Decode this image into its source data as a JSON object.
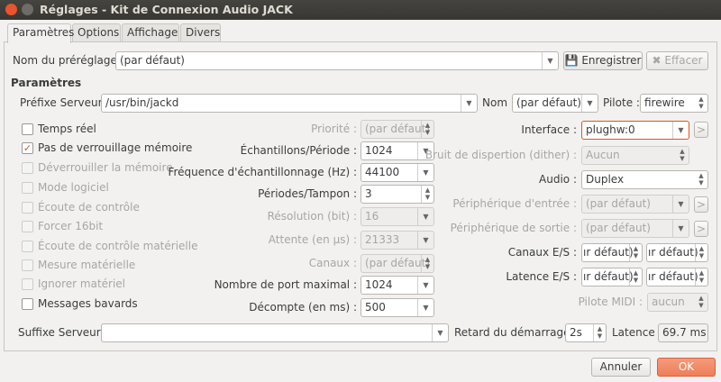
{
  "window": {
    "title": "Réglages - Kit de Connexion Audio JACK"
  },
  "tabs": [
    "Paramètres",
    "Options",
    "Affichage",
    "Divers"
  ],
  "preset": {
    "label": "Nom du préréglage :",
    "value": "(par défaut)",
    "save": "Enregistrer",
    "clear": "Effacer"
  },
  "section_title": "Paramètres",
  "server": {
    "prefix_label": "Préfixe Serveur :",
    "prefix_value": "/usr/bin/jackd",
    "name_label": "Nom :",
    "name_value": "(par défaut)",
    "driver_label": "Pilote :",
    "driver_value": "firewire"
  },
  "checkboxes": [
    {
      "label": "Temps réel",
      "checked": false,
      "enabled": true
    },
    {
      "label": "Pas de verrouillage mémoire",
      "checked": true,
      "enabled": true
    },
    {
      "label": "Déverrouiller la mémoire",
      "checked": false,
      "enabled": false
    },
    {
      "label": "Mode logiciel",
      "checked": false,
      "enabled": false
    },
    {
      "label": "Écoute de contrôle",
      "checked": false,
      "enabled": false
    },
    {
      "label": "Forcer 16bit",
      "checked": false,
      "enabled": false
    },
    {
      "label": "Écoute de contrôle matérielle",
      "checked": false,
      "enabled": false
    },
    {
      "label": "Mesure matérielle",
      "checked": false,
      "enabled": false
    },
    {
      "label": "Ignorer matériel",
      "checked": false,
      "enabled": false
    },
    {
      "label": "Messages bavards",
      "checked": false,
      "enabled": true
    }
  ],
  "middle": [
    {
      "label": "Priorité :",
      "value": "(par défaut)",
      "enabled": false,
      "kind": "spin"
    },
    {
      "label": "Échantillons/Période :",
      "value": "1024",
      "enabled": true,
      "kind": "combo"
    },
    {
      "label": "Fréquence d'échantillonnage (Hz) :",
      "value": "44100",
      "enabled": true,
      "kind": "combo"
    },
    {
      "label": "Périodes/Tampon :",
      "value": "3",
      "enabled": true,
      "kind": "spin"
    },
    {
      "label": "Résolution (bit) :",
      "value": "16",
      "enabled": false,
      "kind": "combo"
    },
    {
      "label": "Attente (en µs) :",
      "value": "21333",
      "enabled": false,
      "kind": "combo"
    },
    {
      "label": "Canaux :",
      "value": "(par défaut)",
      "enabled": false,
      "kind": "spin"
    },
    {
      "label": "Nombre de port maximal :",
      "value": "1024",
      "enabled": true,
      "kind": "combo"
    },
    {
      "label": "Décompte (en ms) :",
      "value": "500",
      "enabled": true,
      "kind": "combo"
    }
  ],
  "right": {
    "interface_label": "Interface :",
    "interface_value": "plughw:0",
    "dither_label": "Bruit de dispertion (dither) :",
    "dither_value": "Aucun",
    "audio_label": "Audio :",
    "audio_value": "Duplex",
    "input_label": "Périphérique d'entrée :",
    "input_value": "(par défaut)",
    "output_label": "Périphérique de sortie :",
    "output_value": "(par défaut)",
    "channels_label": "Canaux E/S :",
    "channels_in": "ır défaut)",
    "channels_out": "ır défaut)",
    "latency_label": "Latence E/S :",
    "latency_in": "ır défaut)",
    "latency_out": "ır défaut)",
    "midi_label": "Pilote MIDI :",
    "midi_value": "aucun",
    "arrow": ">"
  },
  "bottom": {
    "suffix_label": "Suffixe Serveur :",
    "suffix_value": "",
    "delay_label": "Retard du démarrage :",
    "delay_value": "2s",
    "latency_label": "Latence :",
    "latency_value": "69.7 ms"
  },
  "buttons": {
    "cancel": "Annuler",
    "ok": "OK"
  }
}
